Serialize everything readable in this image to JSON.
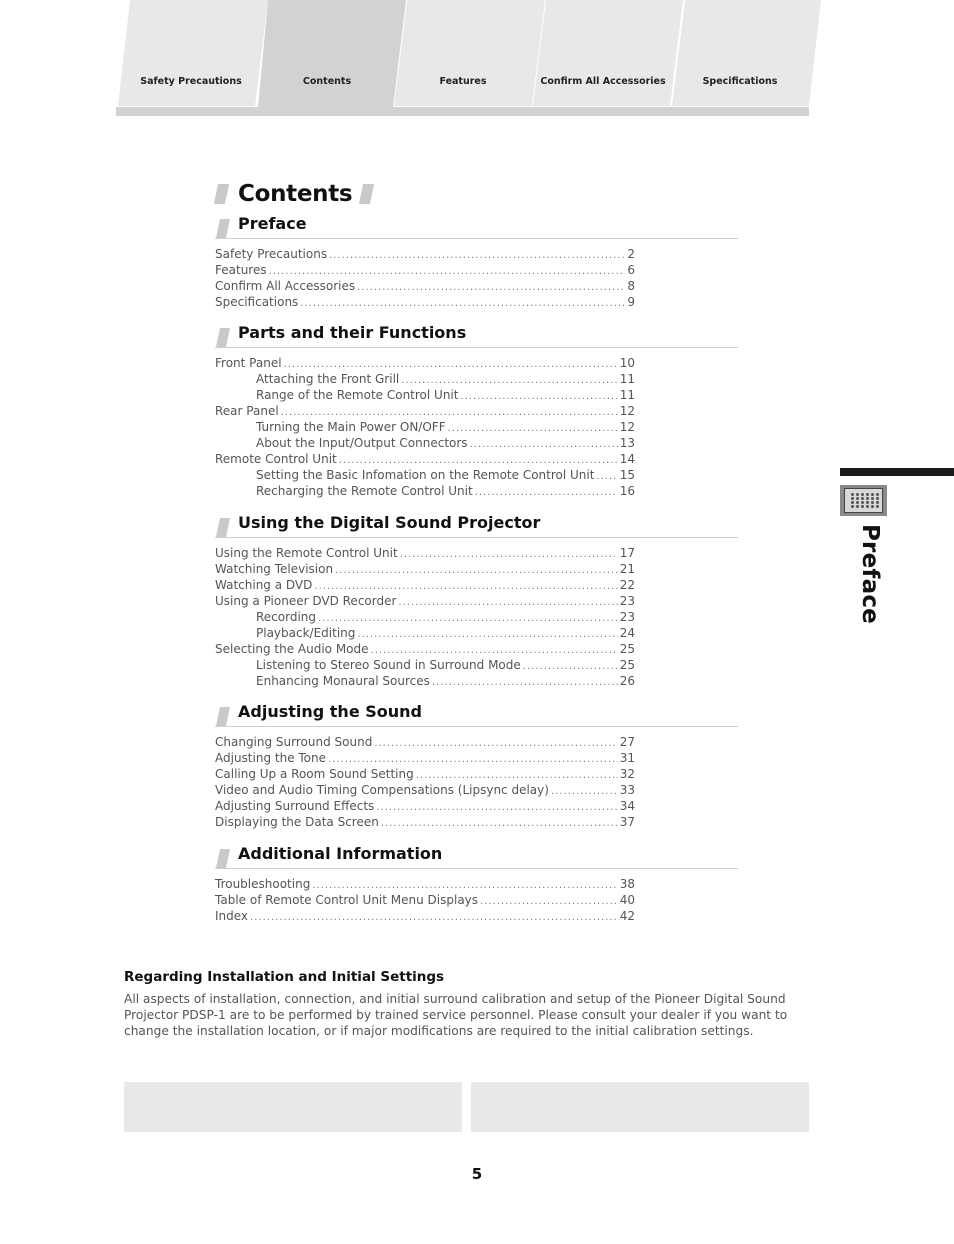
{
  "tabs": [
    {
      "label": "Safety Precautions",
      "active": false
    },
    {
      "label": "Contents",
      "active": true
    },
    {
      "label": "Features",
      "active": false
    },
    {
      "label": "Confirm All Accessories",
      "active": false
    },
    {
      "label": "Specifications",
      "active": false
    }
  ],
  "colors": {
    "tab_inactive": "#e8e8e8",
    "tab_active": "#d2d2d2",
    "slant_accent": "#c9c9c9",
    "side_bar": "#1a1a1a"
  },
  "contents": {
    "title": "Contents",
    "sections": [
      {
        "heading": "Preface",
        "entries": [
          {
            "title": "Safety Precautions",
            "page": "2",
            "level": 1
          },
          {
            "title": "Features",
            "page": "6",
            "level": 1
          },
          {
            "title": "Confirm All Accessories",
            "page": "8",
            "level": 1
          },
          {
            "title": "Specifications",
            "page": "9",
            "level": 1
          }
        ]
      },
      {
        "heading": "Parts and their Functions",
        "entries": [
          {
            "title": "Front Panel",
            "page": "10",
            "level": 1
          },
          {
            "title": "Attaching the Front Grill",
            "page": "11",
            "level": 2
          },
          {
            "title": "Range of the Remote Control Unit",
            "page": "11",
            "level": 2
          },
          {
            "title": "Rear Panel",
            "page": "12",
            "level": 1
          },
          {
            "title": "Turning the Main Power ON/OFF",
            "page": "12",
            "level": 2
          },
          {
            "title": "About the Input/Output Connectors",
            "page": "13",
            "level": 2
          },
          {
            "title": "Remote Control Unit",
            "page": "14",
            "level": 1
          },
          {
            "title": "Setting the Basic Infomation on the Remote Control Unit",
            "page": "15",
            "level": 2
          },
          {
            "title": "Recharging the Remote Control Unit",
            "page": "16",
            "level": 2
          }
        ]
      },
      {
        "heading": "Using the Digital Sound Projector",
        "entries": [
          {
            "title": "Using the Remote Control Unit",
            "page": "17",
            "level": 1
          },
          {
            "title": "Watching Television",
            "page": "21",
            "level": 1
          },
          {
            "title": "Watching a DVD",
            "page": "22",
            "level": 1
          },
          {
            "title": "Using a Pioneer DVD Recorder",
            "page": "23",
            "level": 1
          },
          {
            "title": "Recording",
            "page": "23",
            "level": 2
          },
          {
            "title": "Playback/Editing",
            "page": "24",
            "level": 2
          },
          {
            "title": "Selecting the Audio Mode",
            "page": "25",
            "level": 1
          },
          {
            "title": "Listening to Stereo Sound in Surround Mode",
            "page": "25",
            "level": 2
          },
          {
            "title": "Enhancing Monaural Sources",
            "page": "26",
            "level": 2
          }
        ]
      },
      {
        "heading": "Adjusting the Sound",
        "entries": [
          {
            "title": "Changing Surround Sound",
            "page": "27",
            "level": 1
          },
          {
            "title": "Adjusting the Tone",
            "page": "31",
            "level": 1
          },
          {
            "title": "Calling Up a Room Sound Setting",
            "page": "32",
            "level": 1
          },
          {
            "title": "Video and Audio Timing Compensations (Lipsync delay)",
            "page": "33",
            "level": 1
          },
          {
            "title": "Adjusting Surround Effects",
            "page": "34",
            "level": 1
          },
          {
            "title": "Displaying the Data Screen",
            "page": "37",
            "level": 1
          }
        ]
      },
      {
        "heading": "Additional Information",
        "entries": [
          {
            "title": "Troubleshooting",
            "page": "38",
            "level": 1
          },
          {
            "title": "Table of Remote Control Unit Menu Displays",
            "page": "40",
            "level": 1
          },
          {
            "title": "Index",
            "page": "42",
            "level": 1
          }
        ]
      }
    ]
  },
  "side_tab": {
    "label": "Preface",
    "icon": "speaker-grid-icon"
  },
  "note": {
    "title": "Regarding Installation and Initial Settings",
    "body": "All aspects of installation, connection, and initial surround calibration and setup of the Pioneer Digital Sound Projector PDSP-1 are to be performed by trained service personnel. Please consult your dealer if you want to change the installation location, or if major modifications are required to the initial calibration settings."
  },
  "footer": {
    "page_number": "5"
  }
}
